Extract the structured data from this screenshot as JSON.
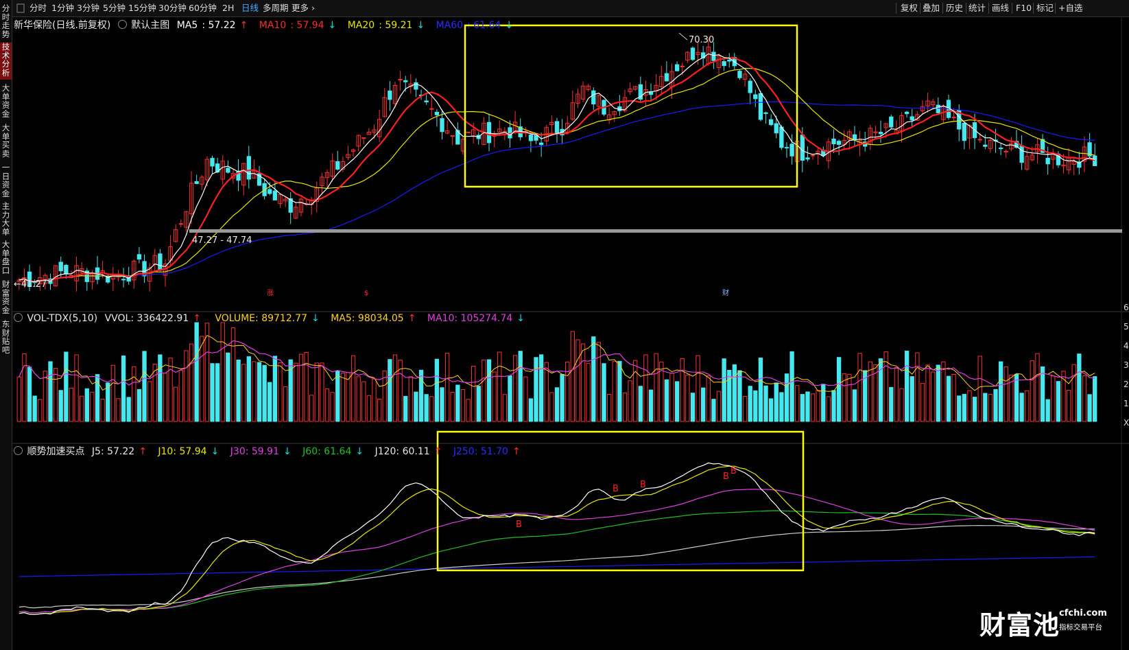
{
  "toolbar": {
    "periods": [
      "分时",
      "1分钟",
      "3分钟",
      "5分钟",
      "15分钟",
      "30分钟",
      "60分钟",
      "2H",
      "日线",
      "多周期",
      "更多"
    ],
    "active_period": "日线",
    "right_items": [
      "复权",
      "叠加",
      "历史",
      "统计",
      "画线",
      "F10",
      "标记",
      "+自选"
    ]
  },
  "sidebar": {
    "items": [
      "分时走势",
      "技术分析",
      "大单资金",
      "大单买卖",
      "一日资金",
      "主力大单",
      "大单盘口",
      "财富资金",
      "东财贴吧"
    ],
    "active": "技术分析"
  },
  "main_chart": {
    "stock_label": "新华保险(日线.前复权)",
    "overlay_label": "默认主图",
    "ma": [
      {
        "name": "MA5",
        "value": "57.22",
        "arrow": "↑",
        "color": "#ffffff"
      },
      {
        "name": "MA10",
        "value": "57.94",
        "arrow": "↓",
        "color": "#ff2a2a"
      },
      {
        "name": "MA20",
        "value": "59.21",
        "arrow": "↓",
        "color": "#e8e800"
      },
      {
        "name": "MA60",
        "value": "61.64",
        "arrow": "↓",
        "color": "#2020ff"
      }
    ],
    "high_label": "70.30",
    "low_label": "41.27",
    "support_label": "47.27 - 47.74",
    "markers": [
      "涨",
      "$",
      "财"
    ]
  },
  "volume": {
    "label": "VOL-TDX(5,10)",
    "vvol": "VVOL: 336422.91",
    "vvol_arrow": "↑",
    "volume": "VOLUME: 89712.77",
    "volume_arrow": "↓",
    "ma5": "MA5: 98034.05",
    "ma5_arrow": "↑",
    "ma10": "MA10: 105274.74",
    "ma10_arrow": "↓",
    "right_ticks": [
      "6",
      "5",
      "4",
      "3",
      "2",
      "1",
      "X"
    ]
  },
  "indicator": {
    "name": "顺势加速买点",
    "j5": "J5: 57.22",
    "j5_arrow": "↑",
    "j10": "J10: 57.94",
    "j10_arrow": "↓",
    "j30": "J30: 59.91",
    "j30_arrow": "↓",
    "j60": "J60: 61.64",
    "j60_arrow": "↓",
    "j120": "J120: 60.11",
    "j120_arrow": "↑",
    "j250": "J250: 51.70",
    "j250_arrow": "↑",
    "buy_marker": "B"
  },
  "watermark": {
    "brand": "财富池",
    "url": "cfchi.com",
    "tagline": "指标交易平台"
  },
  "colors": {
    "up": "#ff3030",
    "down": "#44e8ee",
    "ma5": "#ffffff",
    "ma10": "#ff2020",
    "ma20": "#e8e800",
    "ma60": "#1a1aff",
    "j30": "#e040e0",
    "j60": "#20c020",
    "j120": "#cccccc",
    "highlight": "#ffff00"
  }
}
